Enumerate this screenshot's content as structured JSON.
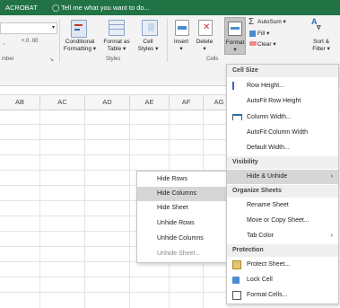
{
  "tabs": {
    "acrobat": "ACROBAT",
    "tell_me": "Tell me what you want to do..."
  },
  "ribbon": {
    "number_group": "mber",
    "styles_group": "Styles",
    "cells_group": "Cells",
    "conditional_formatting": [
      "Conditional",
      "Formatting ▾"
    ],
    "format_as_table": [
      "Format as",
      "Table ▾"
    ],
    "cell_styles": [
      "Cell",
      "Styles ▾"
    ],
    "insert": "Insert",
    "delete": "Delete",
    "format": "Format",
    "autosum": "AutoSum ▾",
    "fill": "Fill ▾",
    "clear": "Clear ▾",
    "sort_filter": [
      "Sort &",
      "Filter ▾"
    ],
    "dec_inc": "+.0 .00",
    "comma": ",",
    "dropdown_arrow": "▾"
  },
  "columns": [
    "AB",
    "AC",
    "AD",
    "AE",
    "AF",
    "AG"
  ],
  "format_menu": {
    "cell_size_header": "Cell Size",
    "row_height": "Row Height...",
    "autofit_row_height": "AutoFit Row Height",
    "column_width": "Column Width...",
    "autofit_column_width": "AutoFit Column Width",
    "default_width": "Default Width...",
    "visibility_header": "Visibility",
    "hide_unhide": "Hide & Unhide",
    "submenu_arrow": "›",
    "organize_header": "Organize Sheets",
    "rename_sheet": "Rename Sheet",
    "move_copy_sheet": "Move or Copy Sheet...",
    "tab_color": "Tab Color",
    "protection_header": "Protection",
    "protect_sheet": "Protect Sheet...",
    "lock_cell": "Lock Cell",
    "format_cells": "Format Cells..."
  },
  "hide_menu": {
    "hide_rows": "Hide Rows",
    "hide_columns": "Hide Columns",
    "hide_sheet": "Hide Sheet",
    "unhide_rows": "Unhide Rows",
    "unhide_columns": "Unhide Columns",
    "unhide_sheet": "Unhide Sheet..."
  },
  "colors": {
    "excel_green": "#217346",
    "highlight": "#d6d6d6"
  }
}
